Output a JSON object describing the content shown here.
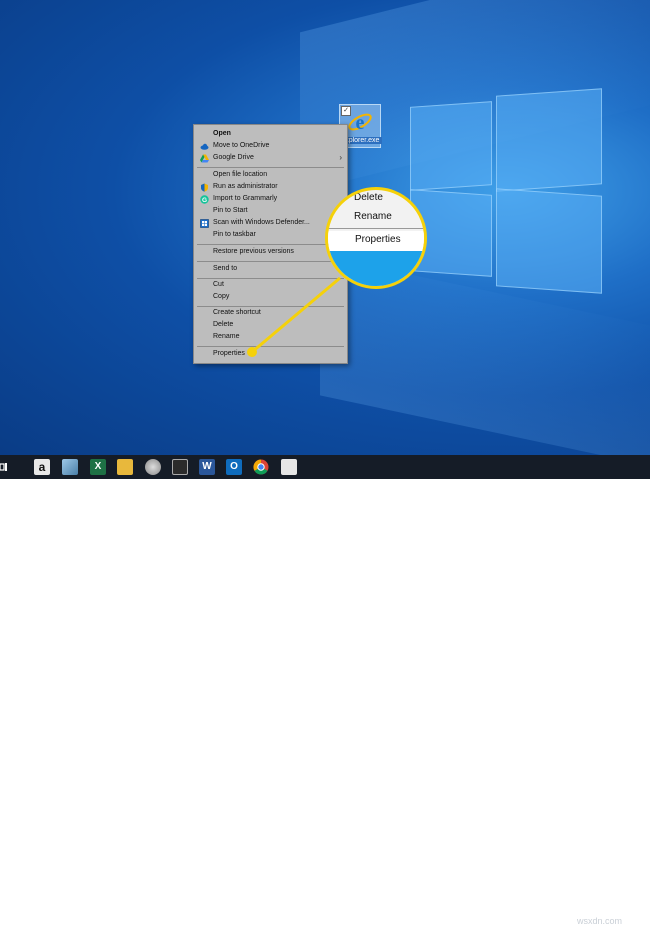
{
  "desktop": {
    "icon_label": "Explorer.exe",
    "icon_name": "internet-explorer-icon",
    "checkbox_mark": "✓"
  },
  "context_menu": {
    "items": [
      {
        "label": "Open",
        "bold": true
      },
      {
        "label": "Move to OneDrive",
        "icon": "onedrive-icon"
      },
      {
        "label": "Google Drive",
        "icon": "google-drive-icon",
        "submenu": "›"
      },
      {
        "label": "Open file location"
      },
      {
        "label": "Run as administrator",
        "icon": "shield-icon"
      },
      {
        "label": "Import to Grammarly",
        "icon": "grammarly-icon"
      },
      {
        "label": "Pin to Start"
      },
      {
        "label": "Scan with Windows Defender...",
        "icon": "defender-icon"
      },
      {
        "label": "Pin to taskbar"
      },
      {
        "label": "Restore previous versions"
      },
      {
        "label": "Send to"
      },
      {
        "label": "Cut"
      },
      {
        "label": "Copy"
      },
      {
        "label": "Create shortcut"
      },
      {
        "label": "Delete"
      },
      {
        "label": "Rename"
      },
      {
        "label": "Properties",
        "highlighted": true
      }
    ]
  },
  "magnifier": {
    "items": [
      "Delete",
      "Rename",
      "Properties"
    ],
    "highlight_color": "#f5d10a"
  },
  "taskbar": {
    "icons": [
      "task-view-icon",
      "amazon-icon",
      "app-icon",
      "excel-icon",
      "file-explorer-icon",
      "app-icon-2",
      "photos-icon",
      "word-icon",
      "outlook-icon",
      "chrome-icon",
      "app-icon-3"
    ],
    "watermark": "wsxdn.com"
  }
}
